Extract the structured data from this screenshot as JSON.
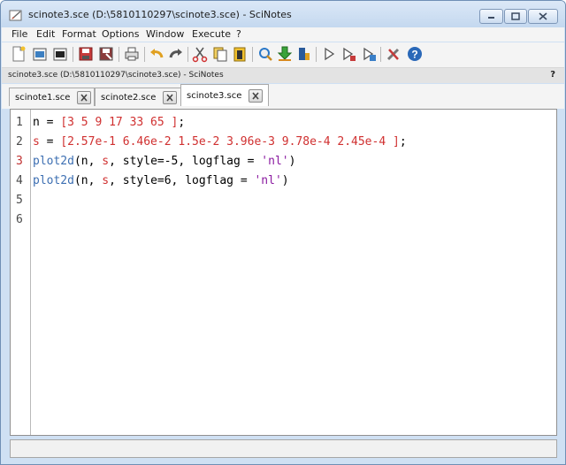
{
  "window": {
    "title": "scinote3.sce (D:\\5810110297\\scinote3.sce) - SciNotes",
    "controls": [
      "minimize",
      "maximize",
      "close"
    ]
  },
  "menu": [
    "File",
    "Edit",
    "Format",
    "Options",
    "Window",
    "Execute",
    "?"
  ],
  "toolbar_icons": [
    "new-file-icon",
    "open-file-icon",
    "open-recent-icon",
    "save-icon",
    "save-as-icon",
    "print-icon",
    "undo-icon",
    "redo-icon",
    "cut-icon",
    "copy-icon",
    "paste-icon",
    "find-replace-icon",
    "load-into-scilab-icon",
    "execute-file-icon",
    "execute-icon",
    "execute-selection-icon",
    "execute-until-icon",
    "preferences-icon",
    "help-icon"
  ],
  "infobar": {
    "path": "scinote3.sce (D:\\5810110297\\scinote3.sce) - SciNotes",
    "help": "?"
  },
  "tabs": [
    {
      "label": "scinote1.sce",
      "active": false
    },
    {
      "label": "scinote2.sce",
      "active": false
    },
    {
      "label": "scinote3.sce",
      "active": true
    }
  ],
  "editor": {
    "line_numbers": [
      "1",
      "2",
      "3",
      "4",
      "5",
      "6"
    ],
    "lines": [
      [
        {
          "t": "n",
          "c": "#000000"
        },
        {
          "t": " = ",
          "c": "#000000"
        },
        {
          "t": "[3 5 9 17 33 65 ]",
          "c": "#d03030"
        },
        {
          "t": ";",
          "c": "#000000"
        }
      ],
      [
        {
          "t": "s",
          "c": "#d03030"
        },
        {
          "t": " = ",
          "c": "#000000"
        },
        {
          "t": "[2.57e-1 6.46e-2 1.5e-2 3.96e-3 9.78e-4 2.45e-4 ]",
          "c": "#d03030"
        },
        {
          "t": ";",
          "c": "#000000"
        }
      ],
      [
        {
          "t": "plot2d",
          "c": "#3d6fb2"
        },
        {
          "t": "(n, ",
          "c": "#000000"
        },
        {
          "t": "s",
          "c": "#d03030"
        },
        {
          "t": ", style=-5, logflag = ",
          "c": "#000000"
        },
        {
          "t": "'nl'",
          "c": "#8a1aa0"
        },
        {
          "t": ")",
          "c": "#000000"
        }
      ],
      [
        {
          "t": "plot2d",
          "c": "#3d6fb2"
        },
        {
          "t": "(n, ",
          "c": "#000000"
        },
        {
          "t": "s",
          "c": "#d03030"
        },
        {
          "t": ", style=6, logflag = ",
          "c": "#000000"
        },
        {
          "t": "'nl'",
          "c": "#8a1aa0"
        },
        {
          "t": ")",
          "c": "#000000"
        }
      ],
      [],
      []
    ]
  },
  "colors": {
    "number": "#d03030",
    "function": "#3d6fb2",
    "string": "#8a1aa0",
    "chrome": "#cfe0f3"
  }
}
